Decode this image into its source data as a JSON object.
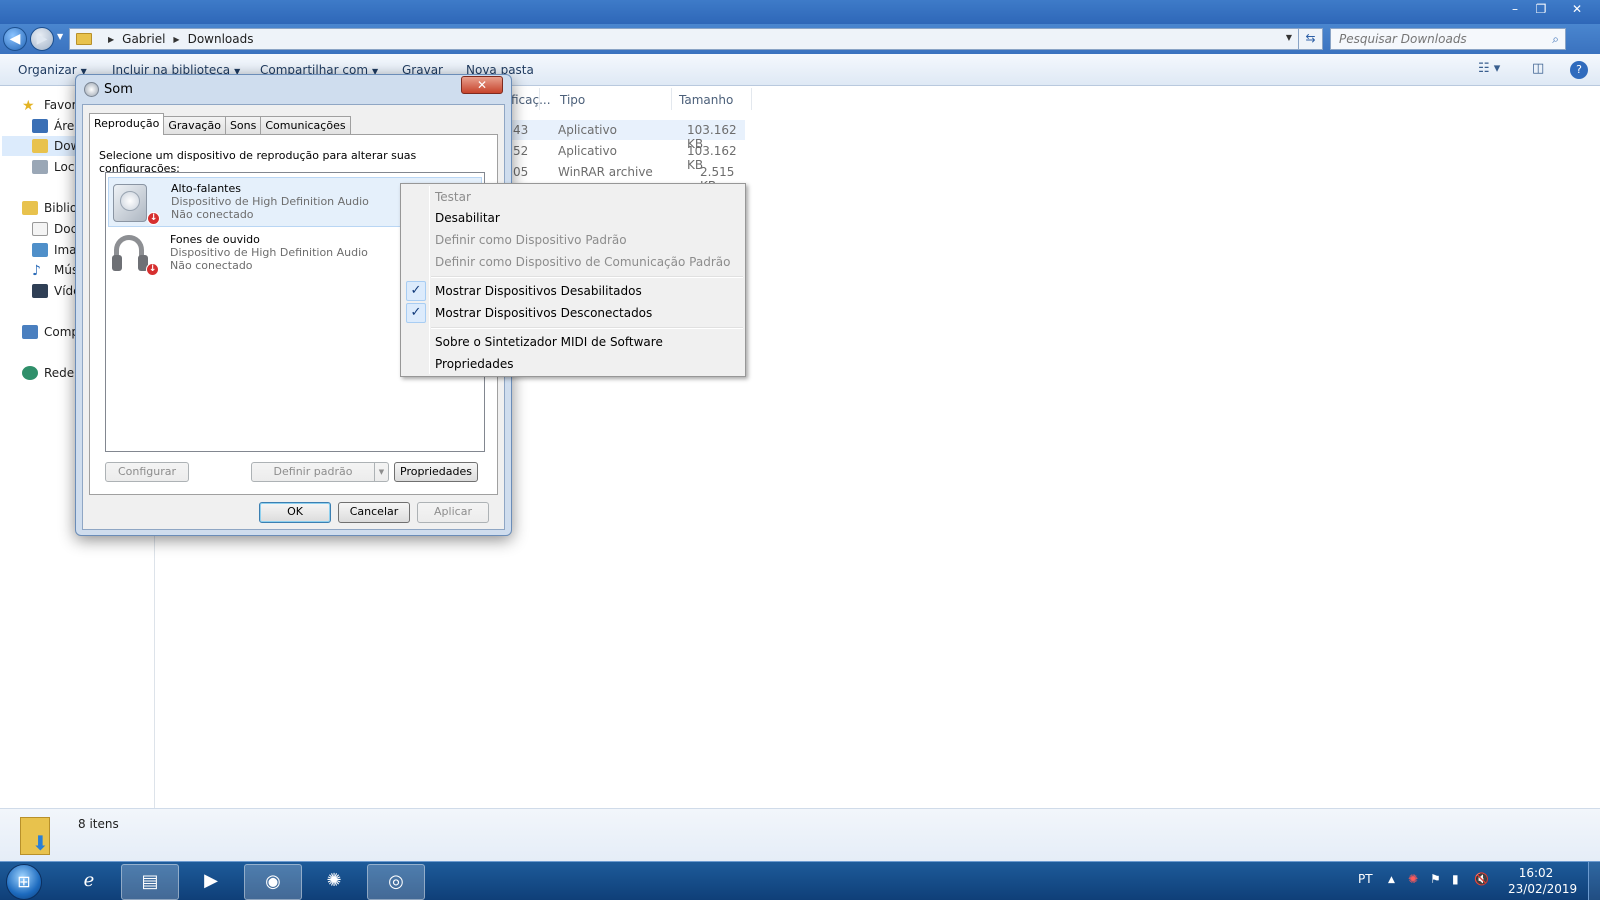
{
  "explorer": {
    "breadcrumb": [
      "Gabriel",
      "Downloads"
    ],
    "search_placeholder": "Pesquisar Downloads",
    "toolbar": {
      "organize": "Organizar",
      "include_library": "Incluir na biblioteca",
      "share_with": "Compartilhar com",
      "burn": "Gravar",
      "new_folder": "Nova pasta"
    },
    "nav": {
      "favorites": "Favorit",
      "desktop": "Área",
      "downloads": "Dow",
      "recent": "Loca",
      "libraries": "Bibliot",
      "documents": "Docu",
      "images": "Imag",
      "music": "Mús",
      "videos": "Víde",
      "computer": "Comp",
      "network": "Rede"
    },
    "columns": {
      "modified": "ficaç...",
      "type": "Tipo",
      "size": "Tamanho"
    },
    "files": [
      {
        "date_fragment": "43",
        "type": "Aplicativo",
        "size": "103.162 KB"
      },
      {
        "date_fragment": "52",
        "type": "Aplicativo",
        "size": "103.162 KB"
      },
      {
        "date_fragment": "05",
        "type": "WinRAR archive",
        "size": "2.515 KB"
      }
    ],
    "status_count": "8 itens"
  },
  "dialog": {
    "title": "Som",
    "tabs": [
      "Reprodução",
      "Gravação",
      "Sons",
      "Comunicações"
    ],
    "instruction": "Selecione um dispositivo de reprodução para alterar suas configurações:",
    "devices": [
      {
        "name": "Alto-falantes",
        "driver": "Dispositivo de High Definition Audio",
        "status": "Não conectado"
      },
      {
        "name": "Fones de ouvido",
        "driver": "Dispositivo de High Definition Audio",
        "status": "Não conectado"
      }
    ],
    "buttons": {
      "configure": "Configurar",
      "set_default": "Definir padrão",
      "properties": "Propriedades",
      "ok": "OK",
      "cancel": "Cancelar",
      "apply": "Aplicar"
    }
  },
  "context_menu": {
    "test": "Testar",
    "disable": "Desabilitar",
    "set_default_device": "Definir como Dispositivo Padrão",
    "set_default_comm": "Definir como Dispositivo de Comunicação Padrão",
    "show_disabled": "Mostrar Dispositivos Desabilitados",
    "show_disconnected": "Mostrar Dispositivos Desconectados",
    "about_midi": "Sobre o Sintetizador MIDI de Software",
    "properties": "Propriedades",
    "check_glyph": "✓"
  },
  "taskbar": {
    "language": "PT",
    "time": "16:02",
    "date": "23/02/2019"
  },
  "colors": {
    "titlebar": "#3e7bc8",
    "taskbar": "#1d5b9a",
    "selection": "#dcebfc"
  }
}
